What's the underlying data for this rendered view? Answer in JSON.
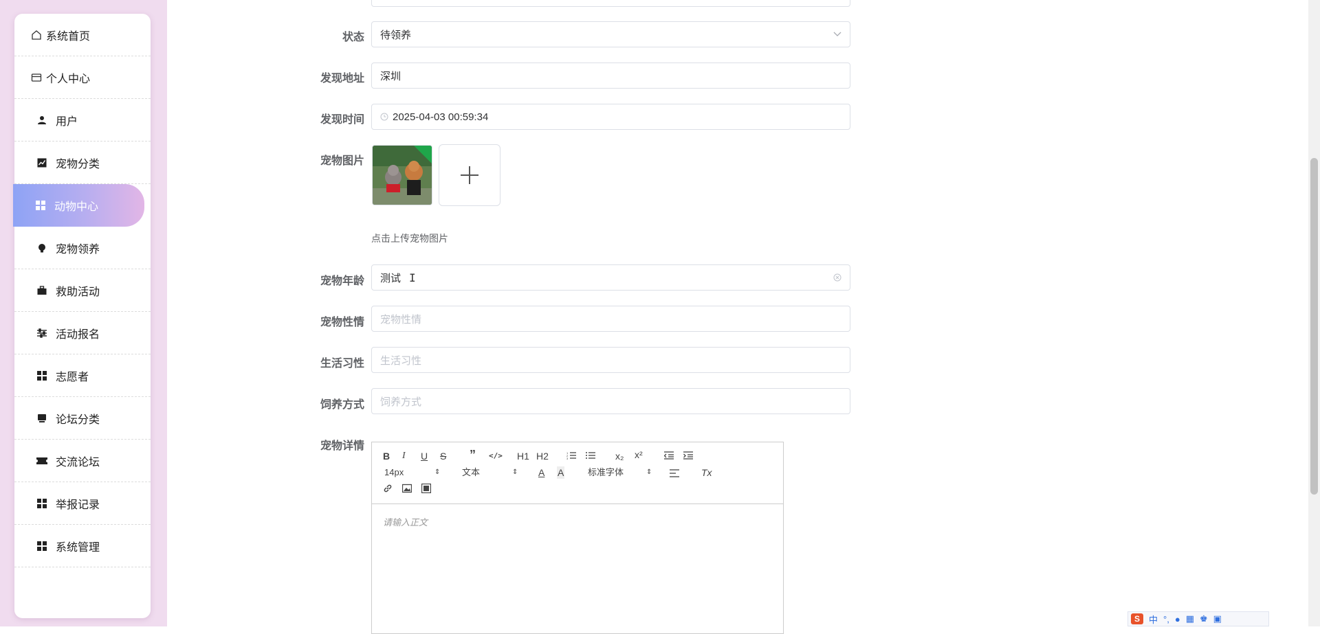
{
  "sidebar": {
    "items": [
      {
        "label": "系统首页",
        "icon": "home-icon"
      },
      {
        "label": "个人中心",
        "icon": "card-icon"
      },
      {
        "label": "用户",
        "icon": "user-icon"
      },
      {
        "label": "宠物分类",
        "icon": "chart-icon"
      },
      {
        "label": "动物中心",
        "icon": "grid-icon",
        "active": true
      },
      {
        "label": "宠物领养",
        "icon": "bulb-icon"
      },
      {
        "label": "救助活动",
        "icon": "briefcase-icon"
      },
      {
        "label": "活动报名",
        "icon": "sliders-icon"
      },
      {
        "label": "志愿者",
        "icon": "grid-icon"
      },
      {
        "label": "论坛分类",
        "icon": "tray-icon"
      },
      {
        "label": "交流论坛",
        "icon": "ticket-icon"
      },
      {
        "label": "举报记录",
        "icon": "grid-icon"
      },
      {
        "label": "系统管理",
        "icon": "grid-icon"
      }
    ]
  },
  "form": {
    "status": {
      "label": "状态",
      "value": "待领养"
    },
    "address": {
      "label": "发现地址",
      "value": "深圳"
    },
    "found_time": {
      "label": "发现时间",
      "value": "2025-04-03 00:59:34"
    },
    "pet_image": {
      "label": "宠物图片",
      "hint": "点击上传宠物图片"
    },
    "pet_age": {
      "label": "宠物年龄",
      "value": "测试"
    },
    "pet_temper": {
      "label": "宠物性情",
      "placeholder": "宠物性情"
    },
    "living_habits": {
      "label": "生活习性",
      "placeholder": "生活习性"
    },
    "feeding": {
      "label": "饲养方式",
      "placeholder": "饲养方式"
    },
    "pet_detail": {
      "label": "宠物详情"
    }
  },
  "editor": {
    "font_size": "14px",
    "block_type": "文本",
    "font_family": "标准字体",
    "placeholder": "请输入正文",
    "buttons": {
      "h1": "H1",
      "h2": "H2",
      "sub": "x₂",
      "sup": "x²",
      "tx": "Tx"
    }
  },
  "ime": {
    "lang": "中"
  },
  "colors": {
    "sidebar_bg": "#f0dcef",
    "active_gradient_start": "#8ea3f5",
    "active_gradient_end": "#e2b6e6",
    "label": "#606266",
    "border": "#dcdfe6",
    "placeholder": "#c0c4cc"
  }
}
